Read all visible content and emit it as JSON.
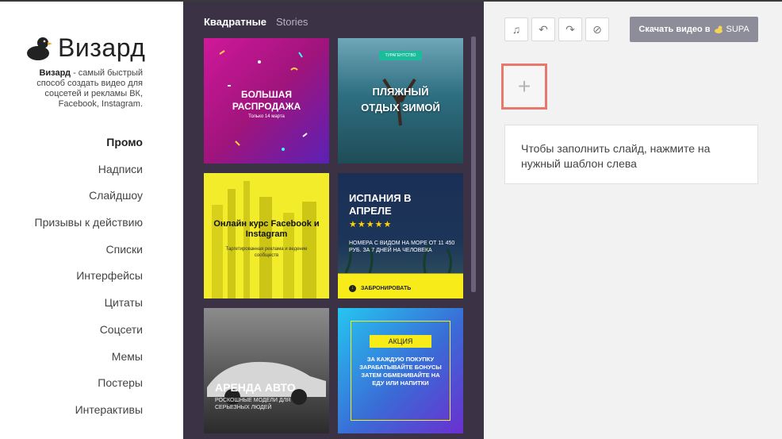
{
  "brand": {
    "name": "Визард",
    "tagline_bold": "Визард",
    "tagline_rest": " - самый быстрый способ создать видео для соцсетей и рекламы ВК, Facebook, Instagram."
  },
  "menu": [
    {
      "label": "Промо",
      "active": true
    },
    {
      "label": "Надписи"
    },
    {
      "label": "Слайдшоу"
    },
    {
      "label": "Призывы к действию"
    },
    {
      "label": "Списки"
    },
    {
      "label": "Интерфейсы"
    },
    {
      "label": "Цитаты"
    },
    {
      "label": "Соцсети"
    },
    {
      "label": "Мемы"
    },
    {
      "label": "Постеры"
    },
    {
      "label": "Интерактивы"
    }
  ],
  "tabs": [
    {
      "label": "Квадратные",
      "active": true
    },
    {
      "label": "Stories"
    }
  ],
  "templates": [
    {
      "title": "Большая распродажа",
      "subtitle": "Только 14 марта"
    },
    {
      "title": "Пляжный отдых зимой",
      "badge": "Турагентство"
    },
    {
      "title": "Онлайн курс Facebook и Instagram",
      "subtitle": "Таргетированная реклама и ведение сообществ"
    },
    {
      "title": "Испания в апреле",
      "subtitle": "Номера с видом на море от 11 450 руб. за 7 дней на человека",
      "cta": "Забронировать",
      "stars": "★★★★★"
    },
    {
      "title": "Аренда авто",
      "subtitle": "Роскошные модели для серьезных людей"
    },
    {
      "badge": "Акция",
      "title": "За каждую покупку зарабатывайте бонусы затем обменивайте на еду или напитки"
    }
  ],
  "toolbar": {
    "music_icon": "♫",
    "undo_icon": "↶",
    "redo_icon": "↷",
    "mute_icon": "⊘",
    "download_label": "Скачать видео в",
    "download_brand": "SUPA"
  },
  "editor": {
    "add_symbol": "+",
    "hint": "Чтобы заполнить слайд, нажмите на нужный шаблон слева"
  },
  "colors": {
    "panel_bg": "#3b3245",
    "editor_bg": "#f2f2f2",
    "add_border": "#e8776e",
    "download_bg": "#8d8d99"
  }
}
